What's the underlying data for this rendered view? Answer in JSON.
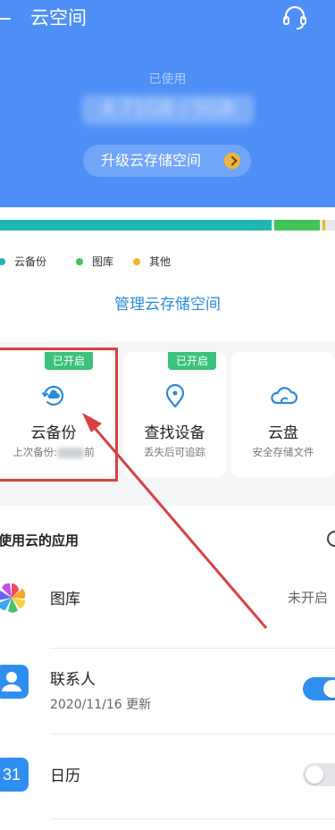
{
  "header": {
    "title": "云空间",
    "used_label": "已使用",
    "used_value": "4.71GB / 5GB",
    "upgrade_label": "升级云存储空间",
    "back_icon": "back-icon",
    "support_icon": "headset-icon"
  },
  "storage": {
    "bar_segments": [
      {
        "name": "云备份",
        "fraction": 0.81,
        "color": "#1fb6b3"
      },
      {
        "name": "图库",
        "fraction": 0.135,
        "color": "#44c25a"
      },
      {
        "name": "其他",
        "fraction": 0.008,
        "color": "#f2b71f"
      }
    ],
    "legend": [
      {
        "label": "云备份",
        "color": "#1fb6b3"
      },
      {
        "label": "图库",
        "color": "#44c25a"
      },
      {
        "label": "其他",
        "color": "#f2b71f"
      }
    ],
    "manage_label": "管理云存储空间"
  },
  "cards": [
    {
      "badge": "已开启",
      "title": "云备份",
      "sub_prefix": "上次备份:",
      "sub_suffix": "前",
      "icon": "cloud-backup-icon"
    },
    {
      "badge": "已开启",
      "title": "查找设备",
      "sub": "丢失后可追踪",
      "icon": "location-pin-icon"
    },
    {
      "title": "云盘",
      "sub": "安全存储文件",
      "icon": "cloud-drive-icon"
    }
  ],
  "apps": {
    "title": "使用云的应用",
    "rows": [
      {
        "label": "图库",
        "status": "未开启",
        "icon": "gallery-icon"
      },
      {
        "label": "联系人",
        "sub": "2020/11/16 更新",
        "toggle": true,
        "icon": "contacts-icon"
      },
      {
        "label": "日历",
        "toggle": false,
        "icon": "calendar-icon",
        "icon_text": "31"
      }
    ]
  },
  "colors": {
    "header_bg": "#4e8ff7",
    "accent_blue": "#2a8bd8",
    "badge_green": "#3cc27a",
    "highlight_red": "#d94141",
    "toggle_on": "#2f8ff0"
  }
}
